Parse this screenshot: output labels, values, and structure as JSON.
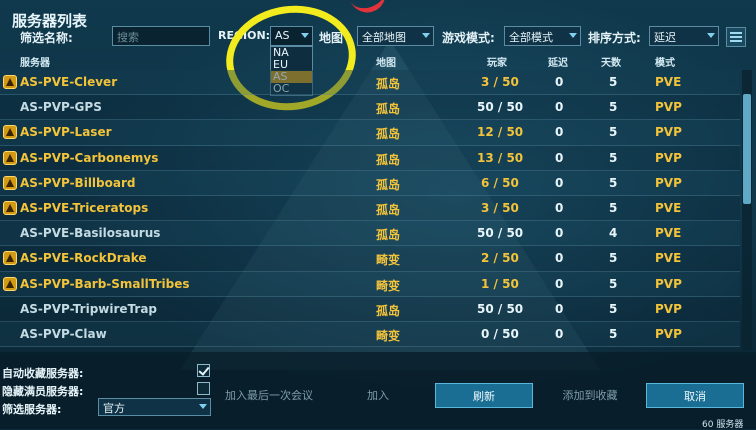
{
  "window": {
    "title": "服务器列表"
  },
  "filters": {
    "name_label": "筛选名称:",
    "search_placeholder": "搜索",
    "region_label": "REGION:",
    "region_value": "AS",
    "region_options": [
      "NA",
      "EU",
      "AS",
      "OC"
    ],
    "region_selected_index": 2,
    "map_label": "地图",
    "map_value": "全部地图",
    "mode_label": "游戏模式:",
    "mode_value": "全部模式",
    "sort_label": "排序方式:",
    "sort_value": "延迟"
  },
  "columns": {
    "server": "服务器",
    "map": "地图",
    "players": "玩家",
    "latency": "延迟",
    "days": "天数",
    "mode": "模式"
  },
  "servers": [
    {
      "name": "AS-PVE-Clever",
      "map": "孤岛",
      "players": "3 / 50",
      "latency": "0",
      "days": "5",
      "mode": "PVE",
      "favorite": true
    },
    {
      "name": "AS-PVP-GPS",
      "map": "孤岛",
      "players": "50 / 50",
      "latency": "0",
      "days": "5",
      "mode": "PVP",
      "favorite": false
    },
    {
      "name": "AS-PVP-Laser",
      "map": "孤岛",
      "players": "12 / 50",
      "latency": "0",
      "days": "5",
      "mode": "PVP",
      "favorite": true
    },
    {
      "name": "AS-PVP-Carbonemys",
      "map": "孤岛",
      "players": "13 / 50",
      "latency": "0",
      "days": "5",
      "mode": "PVP",
      "favorite": true
    },
    {
      "name": "AS-PVP-Billboard",
      "map": "孤岛",
      "players": "6 / 50",
      "latency": "0",
      "days": "5",
      "mode": "PVP",
      "favorite": true
    },
    {
      "name": "AS-PVE-Triceratops",
      "map": "孤岛",
      "players": "3 / 50",
      "latency": "0",
      "days": "5",
      "mode": "PVE",
      "favorite": true
    },
    {
      "name": "AS-PVE-Basilosaurus",
      "map": "孤岛",
      "players": "50 / 50",
      "latency": "0",
      "days": "4",
      "mode": "PVE",
      "favorite": false
    },
    {
      "name": "AS-PVE-RockDrake",
      "map": "畸变",
      "players": "2 / 50",
      "latency": "0",
      "days": "5",
      "mode": "PVE",
      "favorite": true
    },
    {
      "name": "AS-PVP-Barb-SmallTribes",
      "map": "畸变",
      "players": "1 / 50",
      "latency": "0",
      "days": "5",
      "mode": "PVP",
      "favorite": true
    },
    {
      "name": "AS-PVP-TripwireTrap",
      "map": "孤岛",
      "players": "50 / 50",
      "latency": "0",
      "days": "5",
      "mode": "PVP",
      "favorite": false
    },
    {
      "name": "AS-PVP-Claw",
      "map": "畸变",
      "players": "0 / 50",
      "latency": "0",
      "days": "5",
      "mode": "PVP",
      "favorite": false
    }
  ],
  "options": {
    "auto_favorite_label": "自动收藏服务器:",
    "auto_favorite_checked": true,
    "hide_full_label": "隐藏满员服务器:",
    "hide_full_checked": false,
    "server_filter_label": "筛选服务器:",
    "server_filter_value": "官方"
  },
  "buttons": {
    "join_last": "加入最后一次会议",
    "join": "加入",
    "refresh": "刷新",
    "add_favorite": "添加到收藏",
    "cancel": "取消"
  },
  "footer": {
    "server_count": "60 服务器"
  },
  "colors": {
    "accent": "#f3c33a",
    "highlight": "#d39a13",
    "annotation": "#f2eb1e"
  }
}
